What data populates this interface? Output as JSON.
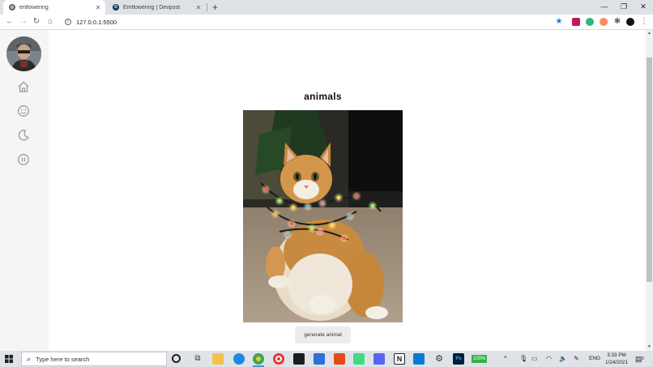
{
  "browser": {
    "tabs": [
      {
        "title": "enflowering",
        "active": true,
        "favicon": "globe-icon"
      },
      {
        "title": "Emflowering | Devpost",
        "active": false,
        "favicon": "devpost-icon"
      }
    ],
    "new_tab_glyph": "+",
    "window_controls": {
      "minimize": "—",
      "restore": "❐",
      "close": "✕"
    },
    "address": "127.0.0.1:5500",
    "bookmark_star_color": "#1a73e8"
  },
  "sidebar": {
    "avatar": "profile-avatar",
    "icons": [
      "home-icon",
      "smile-icon",
      "moon-icon",
      "pause-icon"
    ]
  },
  "main": {
    "title": "animals",
    "image_alt": "Orange and white cat wrapped in Christmas lights",
    "button_label": "generate animal"
  },
  "taskbar": {
    "search_placeholder": "Type here to search",
    "battery": "100%",
    "language": "ENG",
    "time": "3:33 PM",
    "date": "1/24/2021",
    "notifications": "3"
  },
  "colors": {
    "sidebar_bg": "#f5f5f5",
    "button_bg": "#ececec",
    "taskbar_bg": "#dfe3e8",
    "tabstrip_bg": "#dee1e6"
  }
}
